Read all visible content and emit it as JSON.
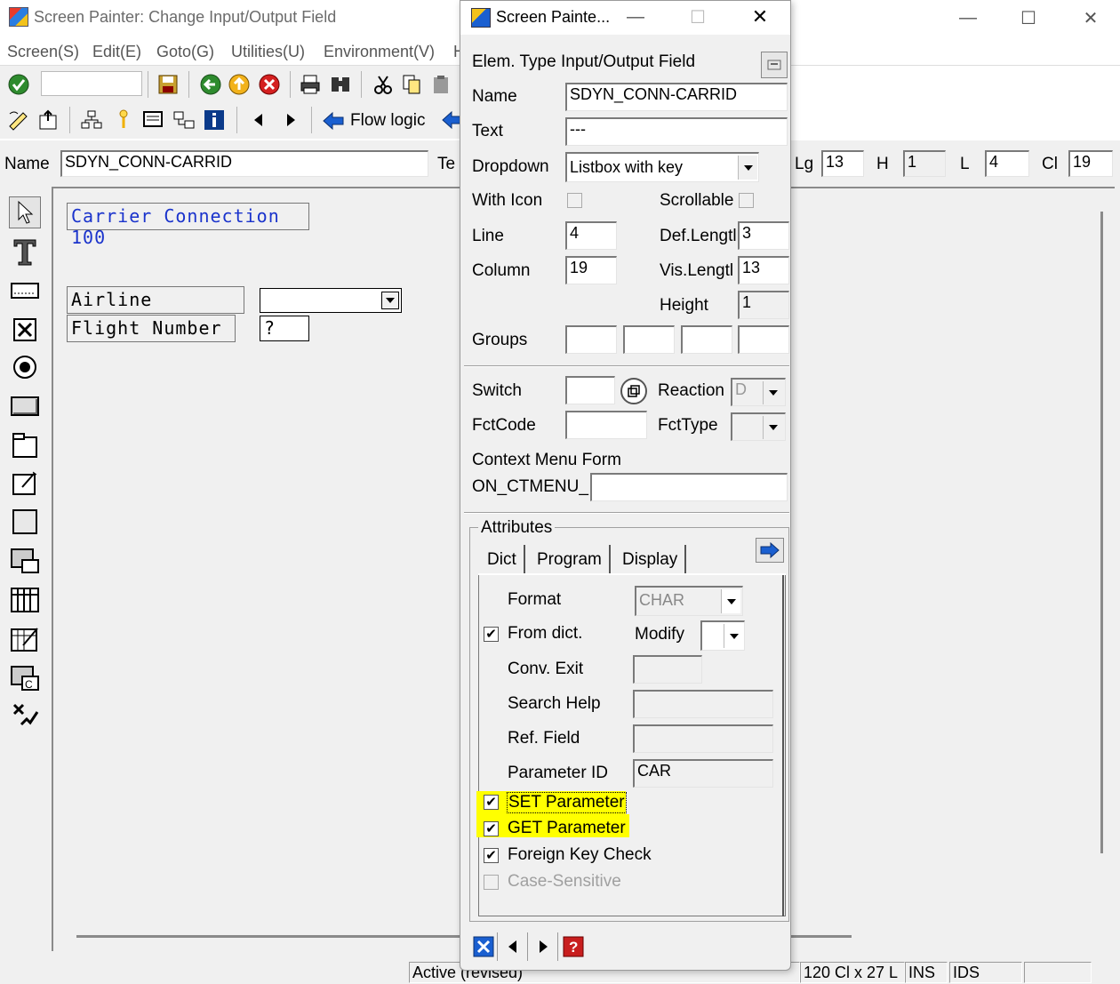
{
  "main": {
    "title": "Screen Painter:  Change Input/Output Field",
    "menu": [
      "Screen(S)",
      "Edit(E)",
      "Goto(G)",
      "Utilities(U)",
      "Environment(V)",
      "H"
    ],
    "toolbar2_flow_logic": "Flow logic",
    "name_label": "Name",
    "name_value": "SDYN_CONN-CARRID",
    "text_label_partial": "Te",
    "lg_label": "Lg",
    "lg_value": "13",
    "h_label": "H",
    "h_value": "1",
    "l_label": "L",
    "l_value": "4",
    "cl_label": "Cl",
    "cl_value": "19",
    "screen": {
      "title_box": "Carrier Connection 100",
      "airline_label": "Airline",
      "flight_label": "Flight Number",
      "flight_value": "?"
    },
    "status": {
      "active": "Active (revised)",
      "size": "120 Cl x 27 L",
      "mode": "INS",
      "system": "IDS"
    }
  },
  "dialog": {
    "title": "Screen Painte...",
    "elem_type_label": "Elem. Type Input/Output Field",
    "name_label": "Name",
    "name_value": "SDYN_CONN-CARRID",
    "text_label": "Text",
    "text_value": "---",
    "dropdown_label": "Dropdown",
    "dropdown_value": "Listbox with key",
    "with_icon_label": "With Icon",
    "scrollable_label": "Scrollable",
    "line_label": "Line",
    "line_value": "4",
    "deflength_label": "Def.Lengtl",
    "deflength_value": "3",
    "column_label": "Column",
    "column_value": "19",
    "vislength_label": "Vis.Lengtl",
    "vislength_value": "13",
    "height_label": "Height",
    "height_value": "1",
    "groups_label": "Groups",
    "switch_label": "Switch",
    "reaction_label": "Reaction",
    "reaction_value": "D",
    "fctcode_label": "FctCode",
    "fcttype_label": "FctType",
    "context_menu_label": "Context Menu Form",
    "on_ctmenu_label": "ON_CTMENU_",
    "attributes_label": "Attributes",
    "tabs": [
      "Dict",
      "Program",
      "Display"
    ],
    "format_label": "Format",
    "format_value": "CHAR",
    "from_dict_label": "From dict.",
    "modify_label": "Modify",
    "conv_exit_label": "Conv. Exit",
    "search_help_label": "Search Help",
    "ref_field_label": "Ref. Field",
    "param_id_label": "Parameter ID",
    "param_id_value": "CAR",
    "set_param_label": "SET Parameter",
    "get_param_label": "GET Parameter",
    "foreign_key_label": "Foreign Key Check",
    "case_sensitive_label": "Case-Sensitive",
    "checks": {
      "with_icon": false,
      "scrollable": false,
      "from_dict": true,
      "set_param": true,
      "get_param": true,
      "foreign_key": true,
      "case_sensitive": false
    },
    "highlight_color": "#ffff00"
  }
}
